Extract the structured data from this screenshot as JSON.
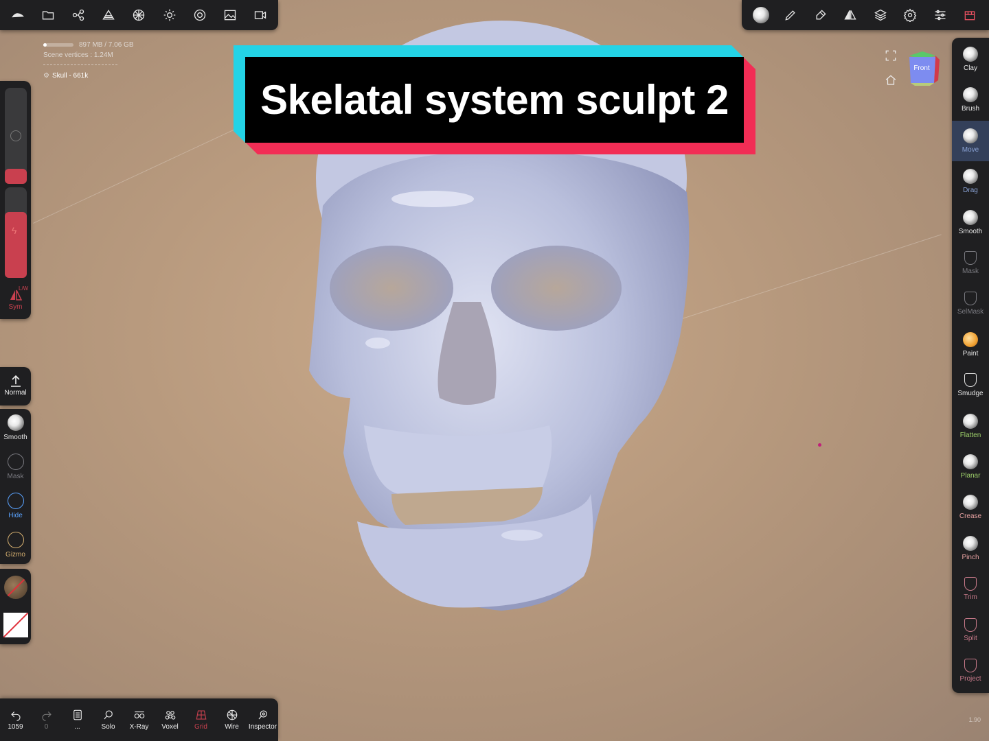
{
  "stats": {
    "memory": "897 MB / 7.06 GB",
    "memory_fraction": 0.12,
    "vertices": "Scene vertices : 1.24M",
    "object": "Skull - 661k"
  },
  "title": "Skelatal system sculpt 2",
  "top_left_icons": [
    "logo-icon",
    "folder-icon",
    "scene-tree-icon",
    "topology-icon",
    "material-icon",
    "light-icon",
    "render-icon",
    "background-icon",
    "camera-icon"
  ],
  "top_right_icons": [
    "matcap-icon",
    "stroke-icon",
    "tool-settings-icon",
    "symmetry-icon",
    "layers-icon",
    "settings-icon",
    "interface-icon",
    "gizmo-menu-icon"
  ],
  "view_cube": {
    "face": "Front"
  },
  "left_panel": {
    "sym_label": "Sym",
    "sym_sub": "L/W",
    "normal_label": "Normal",
    "tools": [
      {
        "label": "Smooth",
        "color": "#e6e6e6"
      },
      {
        "label": "Mask",
        "color": "#7a7a80"
      },
      {
        "label": "Hide",
        "color": "#5aa3ff"
      },
      {
        "label": "Gizmo",
        "color": "#d6b070"
      }
    ]
  },
  "right_tools": [
    {
      "label": "Clay",
      "color": "#e6e6e6",
      "active": false
    },
    {
      "label": "Brush",
      "color": "#e6e6e6",
      "active": false
    },
    {
      "label": "Move",
      "color": "#8aa3d6",
      "active": true
    },
    {
      "label": "Drag",
      "color": "#8aa3d6",
      "active": false
    },
    {
      "label": "Smooth",
      "color": "#e6e6e6",
      "active": false
    },
    {
      "label": "Mask",
      "color": "#7a7a80",
      "active": false
    },
    {
      "label": "SelMask",
      "color": "#7a7a80",
      "active": false
    },
    {
      "label": "Paint",
      "color": "#e6e6e6",
      "active": false
    },
    {
      "label": "Smudge",
      "color": "#e6e6e6",
      "active": false
    },
    {
      "label": "Flatten",
      "color": "#9ed06a",
      "active": false
    },
    {
      "label": "Planar",
      "color": "#9ed06a",
      "active": false
    },
    {
      "label": "Crease",
      "color": "#e6a0a0",
      "active": false
    },
    {
      "label": "Pinch",
      "color": "#e6a0a0",
      "active": false
    },
    {
      "label": "Trim",
      "color": "#c87a8a",
      "active": false
    },
    {
      "label": "Split",
      "color": "#c87a8a",
      "active": false
    },
    {
      "label": "Project",
      "color": "#c87a8a",
      "active": false
    }
  ],
  "bottom_bar": [
    {
      "label": "1059",
      "icon": "undo-icon"
    },
    {
      "label": "0",
      "icon": "redo-icon"
    },
    {
      "label": "...",
      "icon": "menu-icon"
    },
    {
      "label": "Solo",
      "icon": "search-icon"
    },
    {
      "label": "X-Ray",
      "icon": "xray-icon"
    },
    {
      "label": "Voxel",
      "icon": "voxel-icon"
    },
    {
      "label": "Grid",
      "icon": "grid-icon"
    },
    {
      "label": "Wire",
      "icon": "wire-icon"
    },
    {
      "label": "Inspector",
      "icon": "inspector-icon"
    }
  ],
  "version": "1.90"
}
